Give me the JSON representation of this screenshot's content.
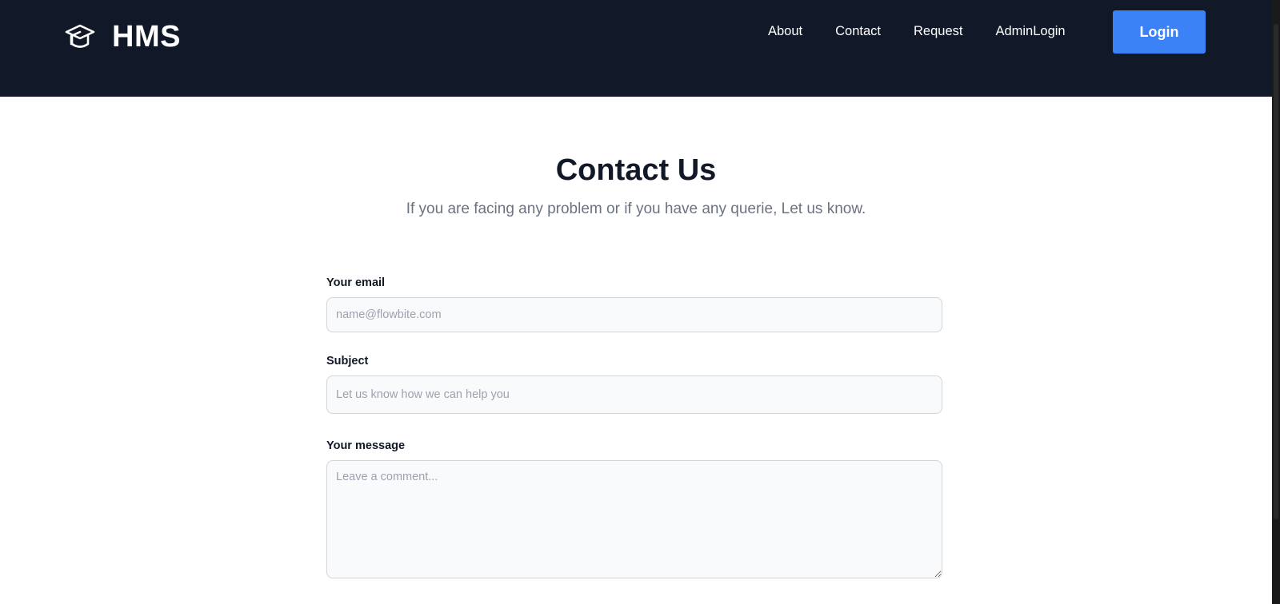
{
  "header": {
    "brand_icon": "graduation-cap-icon",
    "brand_name": "HMS",
    "nav": [
      {
        "label": "About"
      },
      {
        "label": "Contact"
      },
      {
        "label": "Request"
      },
      {
        "label": "AdminLogin"
      }
    ],
    "login_label": "Login"
  },
  "main": {
    "title": "Contact Us",
    "subtitle": "If you are facing any problem or if you have any querie, Let us know.",
    "form": {
      "email": {
        "label": "Your email",
        "placeholder": "name@flowbite.com",
        "value": ""
      },
      "subject": {
        "label": "Subject",
        "placeholder": "Let us know how we can help you",
        "value": ""
      },
      "message": {
        "label": "Your message",
        "placeholder": "Leave a comment...",
        "value": ""
      }
    }
  },
  "colors": {
    "header_bg": "#111827",
    "accent": "#3b82f6",
    "title": "#111827",
    "subtitle": "#6b7280",
    "input_bg": "#f9fafb",
    "input_border": "#d1d5db"
  }
}
